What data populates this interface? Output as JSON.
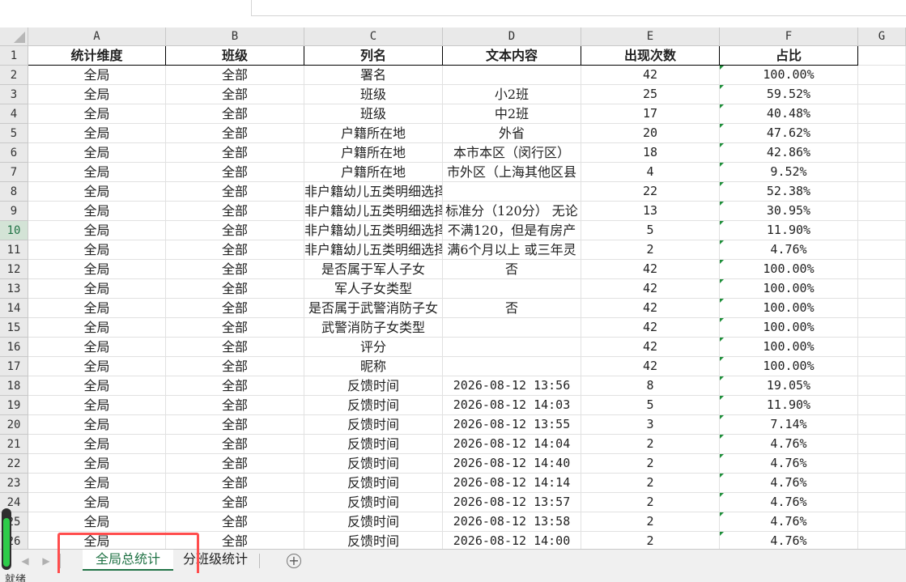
{
  "columns": [
    "A",
    "B",
    "C",
    "D",
    "E",
    "F",
    "G"
  ],
  "header": {
    "A": "统计维度",
    "B": "班级",
    "C": "列名",
    "D": "文本内容",
    "E": "出现次数",
    "F": "占比"
  },
  "rows": [
    {
      "n": "2",
      "a": "全局",
      "b": "全部",
      "c": "署名",
      "d": "",
      "e": "42",
      "f": "100.00%"
    },
    {
      "n": "3",
      "a": "全局",
      "b": "全部",
      "c": "班级",
      "d": "小2班",
      "e": "25",
      "f": "59.52%"
    },
    {
      "n": "4",
      "a": "全局",
      "b": "全部",
      "c": "班级",
      "d": "中2班",
      "e": "17",
      "f": "40.48%"
    },
    {
      "n": "5",
      "a": "全局",
      "b": "全部",
      "c": "户籍所在地",
      "d": "外省",
      "e": "20",
      "f": "47.62%"
    },
    {
      "n": "6",
      "a": "全局",
      "b": "全部",
      "c": "户籍所在地",
      "d": "本市本区（闵行区）",
      "e": "18",
      "f": "42.86%"
    },
    {
      "n": "7",
      "a": "全局",
      "b": "全部",
      "c": "户籍所在地",
      "d": "市外区（上海其他区县",
      "e": "4",
      "f": "9.52%"
    },
    {
      "n": "8",
      "a": "全局",
      "b": "全部",
      "c": "非户籍幼儿五类明细选择",
      "d": "",
      "e": "22",
      "f": "52.38%"
    },
    {
      "n": "9",
      "a": "全局",
      "b": "全部",
      "c": "非户籍幼儿五类明细选择",
      "d": "标准分（120分） 无论",
      "e": "13",
      "f": "30.95%"
    },
    {
      "n": "10",
      "a": "全局",
      "b": "全部",
      "c": "非户籍幼儿五类明细选择",
      "d": "不满120，但是有房产",
      "e": "5",
      "f": "11.90%"
    },
    {
      "n": "11",
      "a": "全局",
      "b": "全部",
      "c": "非户籍幼儿五类明细选择",
      "d": "满6个月以上 或三年灵",
      "e": "2",
      "f": "4.76%"
    },
    {
      "n": "12",
      "a": "全局",
      "b": "全部",
      "c": "是否属于军人子女",
      "d": "否",
      "e": "42",
      "f": "100.00%"
    },
    {
      "n": "13",
      "a": "全局",
      "b": "全部",
      "c": "军人子女类型",
      "d": "",
      "e": "42",
      "f": "100.00%"
    },
    {
      "n": "14",
      "a": "全局",
      "b": "全部",
      "c": "是否属于武警消防子女",
      "d": "否",
      "e": "42",
      "f": "100.00%"
    },
    {
      "n": "15",
      "a": "全局",
      "b": "全部",
      "c": "武警消防子女类型",
      "d": "",
      "e": "42",
      "f": "100.00%"
    },
    {
      "n": "16",
      "a": "全局",
      "b": "全部",
      "c": "评分",
      "d": "",
      "e": "42",
      "f": "100.00%"
    },
    {
      "n": "17",
      "a": "全局",
      "b": "全部",
      "c": "昵称",
      "d": "",
      "e": "42",
      "f": "100.00%"
    },
    {
      "n": "18",
      "a": "全局",
      "b": "全部",
      "c": "反馈时间",
      "d": "2026-08-12 13:56",
      "e": "8",
      "f": "19.05%"
    },
    {
      "n": "19",
      "a": "全局",
      "b": "全部",
      "c": "反馈时间",
      "d": "2026-08-12 14:03",
      "e": "5",
      "f": "11.90%"
    },
    {
      "n": "20",
      "a": "全局",
      "b": "全部",
      "c": "反馈时间",
      "d": "2026-08-12 13:55",
      "e": "3",
      "f": "7.14%"
    },
    {
      "n": "21",
      "a": "全局",
      "b": "全部",
      "c": "反馈时间",
      "d": "2026-08-12 14:04",
      "e": "2",
      "f": "4.76%"
    },
    {
      "n": "22",
      "a": "全局",
      "b": "全部",
      "c": "反馈时间",
      "d": "2026-08-12 14:40",
      "e": "2",
      "f": "4.76%"
    },
    {
      "n": "23",
      "a": "全局",
      "b": "全部",
      "c": "反馈时间",
      "d": "2026-08-12 14:14",
      "e": "2",
      "f": "4.76%"
    },
    {
      "n": "24",
      "a": "全局",
      "b": "全部",
      "c": "反馈时间",
      "d": "2026-08-12 13:57",
      "e": "2",
      "f": "4.76%"
    },
    {
      "n": "25",
      "a": "全局",
      "b": "全部",
      "c": "反馈时间",
      "d": "2026-08-12 13:58",
      "e": "2",
      "f": "4.76%"
    },
    {
      "n": "26",
      "a": "全局",
      "b": "全部",
      "c": "反馈时间",
      "d": "2026-08-12 14:00",
      "e": "2",
      "f": "4.76%"
    }
  ],
  "active_row": "10",
  "tabs": [
    {
      "label": "全局总统计",
      "active": true
    },
    {
      "label": "分班级统计",
      "active": false
    }
  ],
  "add_sheet_label": "+",
  "status_text": "就绪",
  "icons": {
    "prev": "chevron-left-icon",
    "next": "chevron-right-icon",
    "add": "plus-circle-icon"
  },
  "colors": {
    "accent": "#217346",
    "highlight": "#ff4d4d",
    "flag": "#1e8f3a"
  }
}
